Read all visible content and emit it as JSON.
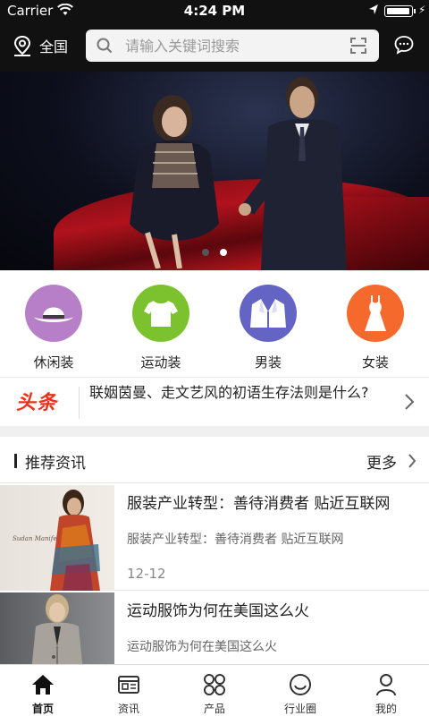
{
  "status_bar": {
    "carrier": "Carrier",
    "time": "4:24 PM",
    "battery_level": 0.95
  },
  "header": {
    "region_label": "全国",
    "search_placeholder": "请输入关键词搜索",
    "icons": [
      "location-pin-icon",
      "search-icon",
      "scan-icon",
      "message-icon"
    ]
  },
  "banner": {
    "slide_count": 2,
    "active_slide": 2
  },
  "categories": [
    {
      "label": "休闲装",
      "icon": "hat-icon",
      "color": "#b77fc8"
    },
    {
      "label": "运动装",
      "icon": "tshirt-icon",
      "color": "#7cc22e"
    },
    {
      "label": "男装",
      "icon": "suit-icon",
      "color": "#6364c4"
    },
    {
      "label": "女装",
      "icon": "dress-icon",
      "color": "#f5692c"
    }
  ],
  "headline": {
    "tag": "头条",
    "text": "联姻茵曼、走文艺风的初语生存法则是什么?"
  },
  "section": {
    "title": "推荐资讯",
    "more": "更多"
  },
  "news": [
    {
      "title": "服装产业转型：善待消费者 贴近互联网",
      "summary": "服装产业转型：善待消费者 贴近互联网",
      "date": "12-12"
    },
    {
      "title": "运动服饰为何在美国这么火",
      "summary": "运动服饰为何在美国这么火",
      "date": ""
    }
  ],
  "tabbar": {
    "active": "首页",
    "items": [
      {
        "label": "首页",
        "icon": "home-icon"
      },
      {
        "label": "资讯",
        "icon": "news-icon"
      },
      {
        "label": "产品",
        "icon": "grid-icon"
      },
      {
        "label": "行业圈",
        "icon": "smile-circle-icon"
      },
      {
        "label": "我的",
        "icon": "person-icon"
      }
    ]
  },
  "colors": {
    "headline_red": "#e9311d",
    "header_bg": "#111111"
  }
}
